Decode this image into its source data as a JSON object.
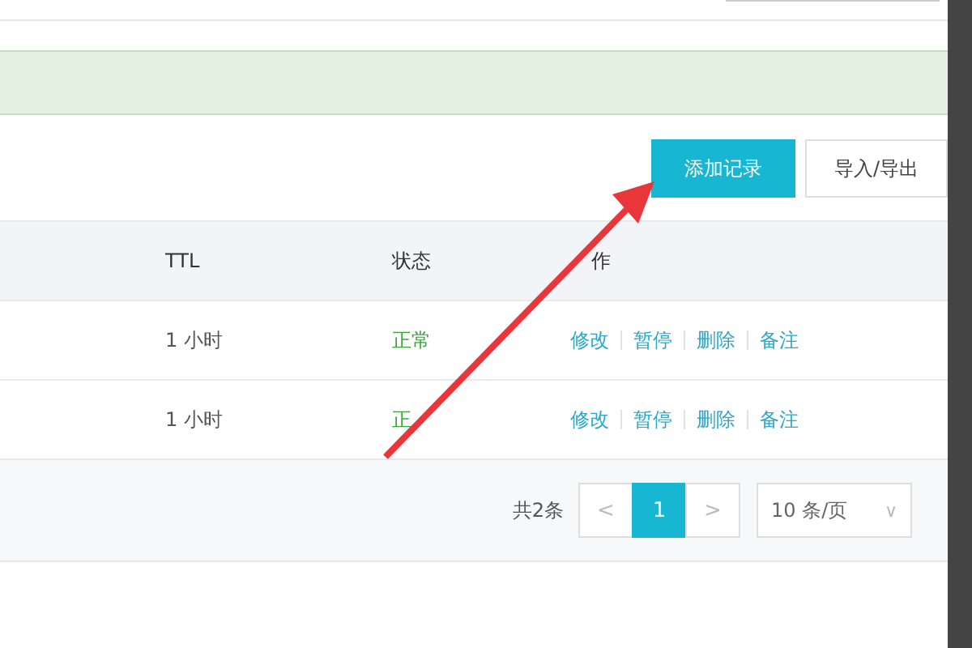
{
  "toolbar": {
    "buttons": [
      {
        "label": "添加记录",
        "kind": "primary"
      },
      {
        "label": "导入/导出",
        "kind": "default"
      }
    ]
  },
  "table": {
    "columns": [
      "TTL",
      "状态",
      "作"
    ],
    "rows": [
      {
        "ttl": "1 小时",
        "status": "正常",
        "actions": [
          "修改",
          "暂停",
          "删除",
          "备注"
        ]
      },
      {
        "ttl": "1 小时",
        "status": "正",
        "actions": [
          "修改",
          "暂停",
          "删除",
          "备注"
        ]
      }
    ]
  },
  "pagination": {
    "total": "共2条",
    "prev": "<",
    "pages": [
      {
        "label": "1",
        "selected": true
      }
    ],
    "next": ">",
    "page_size": "10 条/页",
    "dropdown": "∨"
  }
}
